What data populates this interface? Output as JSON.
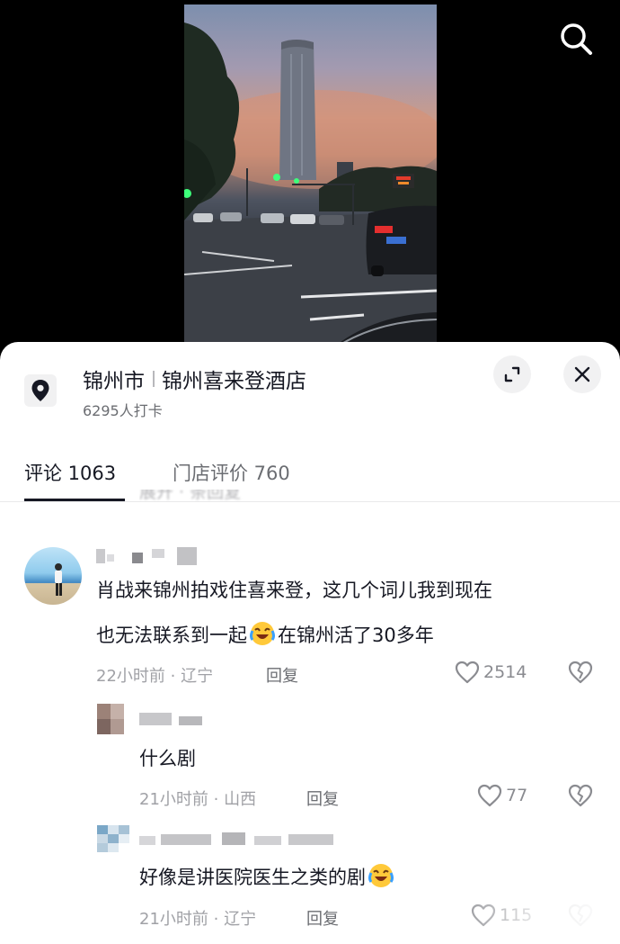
{
  "location": {
    "city": "锦州市",
    "place": "锦州喜来登酒店",
    "checkins": "6295人打卡"
  },
  "tabs": [
    {
      "label": "评论 1063"
    },
    {
      "label": "门店评价 760"
    }
  ],
  "partial_text": "展开 · 条回复",
  "comments": [
    {
      "text_line1": "肖战来锦州拍戏住喜来登，这几个词儿我到现在",
      "text_line2_a": "也无法联系到一起",
      "text_line2_b": "在锦州活了30多年",
      "meta": "22小时前 · 辽宁",
      "reply": "回复",
      "likes": "2514"
    },
    {
      "text": "什么剧",
      "meta": "21小时前 · 山西",
      "reply": "回复",
      "likes": "77"
    },
    {
      "text_a": "好像是讲医院医生之类的剧",
      "meta": "21小时前 · 辽宁",
      "reply": "回复",
      "likes": "115"
    }
  ],
  "icons": {
    "search": "search-icon",
    "pin": "location-pin-icon",
    "expand": "expand-icon",
    "close": "close-icon",
    "like": "heart-icon",
    "dislike": "broken-heart-icon",
    "emoji": "laughing-crying-emoji"
  },
  "colors": {
    "text_primary": "#161823",
    "text_secondary": "#6b6d72",
    "text_meta": "#a0a1a6",
    "sheet_bg": "#ffffff",
    "chip_bg": "#f1f1f2"
  }
}
